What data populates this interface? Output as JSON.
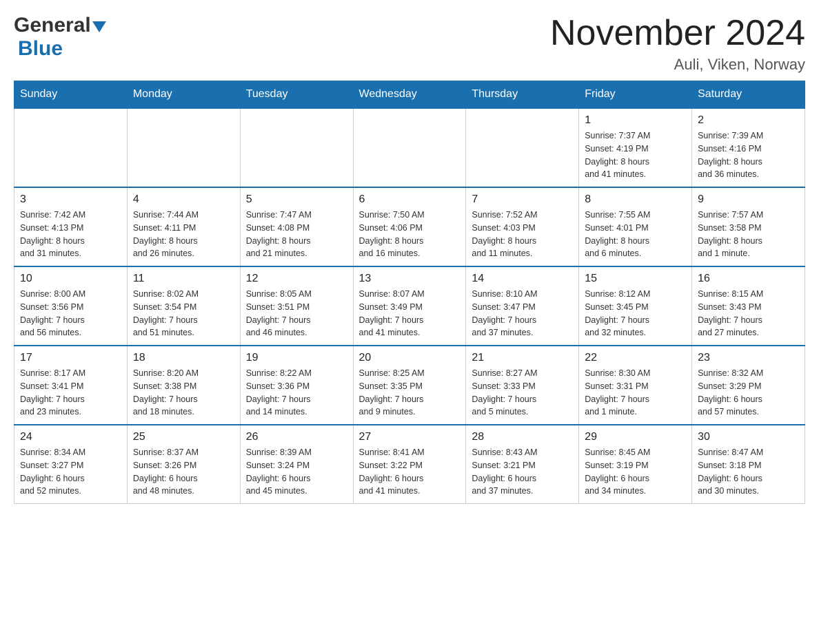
{
  "header": {
    "title": "November 2024",
    "location": "Auli, Viken, Norway",
    "logo_general": "General",
    "logo_blue": "Blue"
  },
  "days_of_week": [
    "Sunday",
    "Monday",
    "Tuesday",
    "Wednesday",
    "Thursday",
    "Friday",
    "Saturday"
  ],
  "weeks": [
    {
      "days": [
        {
          "number": "",
          "info": "",
          "empty": true
        },
        {
          "number": "",
          "info": "",
          "empty": true
        },
        {
          "number": "",
          "info": "",
          "empty": true
        },
        {
          "number": "",
          "info": "",
          "empty": true
        },
        {
          "number": "",
          "info": "",
          "empty": true
        },
        {
          "number": "1",
          "info": "Sunrise: 7:37 AM\nSunset: 4:19 PM\nDaylight: 8 hours\nand 41 minutes.",
          "empty": false
        },
        {
          "number": "2",
          "info": "Sunrise: 7:39 AM\nSunset: 4:16 PM\nDaylight: 8 hours\nand 36 minutes.",
          "empty": false
        }
      ]
    },
    {
      "days": [
        {
          "number": "3",
          "info": "Sunrise: 7:42 AM\nSunset: 4:13 PM\nDaylight: 8 hours\nand 31 minutes.",
          "empty": false
        },
        {
          "number": "4",
          "info": "Sunrise: 7:44 AM\nSunset: 4:11 PM\nDaylight: 8 hours\nand 26 minutes.",
          "empty": false
        },
        {
          "number": "5",
          "info": "Sunrise: 7:47 AM\nSunset: 4:08 PM\nDaylight: 8 hours\nand 21 minutes.",
          "empty": false
        },
        {
          "number": "6",
          "info": "Sunrise: 7:50 AM\nSunset: 4:06 PM\nDaylight: 8 hours\nand 16 minutes.",
          "empty": false
        },
        {
          "number": "7",
          "info": "Sunrise: 7:52 AM\nSunset: 4:03 PM\nDaylight: 8 hours\nand 11 minutes.",
          "empty": false
        },
        {
          "number": "8",
          "info": "Sunrise: 7:55 AM\nSunset: 4:01 PM\nDaylight: 8 hours\nand 6 minutes.",
          "empty": false
        },
        {
          "number": "9",
          "info": "Sunrise: 7:57 AM\nSunset: 3:58 PM\nDaylight: 8 hours\nand 1 minute.",
          "empty": false
        }
      ]
    },
    {
      "days": [
        {
          "number": "10",
          "info": "Sunrise: 8:00 AM\nSunset: 3:56 PM\nDaylight: 7 hours\nand 56 minutes.",
          "empty": false
        },
        {
          "number": "11",
          "info": "Sunrise: 8:02 AM\nSunset: 3:54 PM\nDaylight: 7 hours\nand 51 minutes.",
          "empty": false
        },
        {
          "number": "12",
          "info": "Sunrise: 8:05 AM\nSunset: 3:51 PM\nDaylight: 7 hours\nand 46 minutes.",
          "empty": false
        },
        {
          "number": "13",
          "info": "Sunrise: 8:07 AM\nSunset: 3:49 PM\nDaylight: 7 hours\nand 41 minutes.",
          "empty": false
        },
        {
          "number": "14",
          "info": "Sunrise: 8:10 AM\nSunset: 3:47 PM\nDaylight: 7 hours\nand 37 minutes.",
          "empty": false
        },
        {
          "number": "15",
          "info": "Sunrise: 8:12 AM\nSunset: 3:45 PM\nDaylight: 7 hours\nand 32 minutes.",
          "empty": false
        },
        {
          "number": "16",
          "info": "Sunrise: 8:15 AM\nSunset: 3:43 PM\nDaylight: 7 hours\nand 27 minutes.",
          "empty": false
        }
      ]
    },
    {
      "days": [
        {
          "number": "17",
          "info": "Sunrise: 8:17 AM\nSunset: 3:41 PM\nDaylight: 7 hours\nand 23 minutes.",
          "empty": false
        },
        {
          "number": "18",
          "info": "Sunrise: 8:20 AM\nSunset: 3:38 PM\nDaylight: 7 hours\nand 18 minutes.",
          "empty": false
        },
        {
          "number": "19",
          "info": "Sunrise: 8:22 AM\nSunset: 3:36 PM\nDaylight: 7 hours\nand 14 minutes.",
          "empty": false
        },
        {
          "number": "20",
          "info": "Sunrise: 8:25 AM\nSunset: 3:35 PM\nDaylight: 7 hours\nand 9 minutes.",
          "empty": false
        },
        {
          "number": "21",
          "info": "Sunrise: 8:27 AM\nSunset: 3:33 PM\nDaylight: 7 hours\nand 5 minutes.",
          "empty": false
        },
        {
          "number": "22",
          "info": "Sunrise: 8:30 AM\nSunset: 3:31 PM\nDaylight: 7 hours\nand 1 minute.",
          "empty": false
        },
        {
          "number": "23",
          "info": "Sunrise: 8:32 AM\nSunset: 3:29 PM\nDaylight: 6 hours\nand 57 minutes.",
          "empty": false
        }
      ]
    },
    {
      "days": [
        {
          "number": "24",
          "info": "Sunrise: 8:34 AM\nSunset: 3:27 PM\nDaylight: 6 hours\nand 52 minutes.",
          "empty": false
        },
        {
          "number": "25",
          "info": "Sunrise: 8:37 AM\nSunset: 3:26 PM\nDaylight: 6 hours\nand 48 minutes.",
          "empty": false
        },
        {
          "number": "26",
          "info": "Sunrise: 8:39 AM\nSunset: 3:24 PM\nDaylight: 6 hours\nand 45 minutes.",
          "empty": false
        },
        {
          "number": "27",
          "info": "Sunrise: 8:41 AM\nSunset: 3:22 PM\nDaylight: 6 hours\nand 41 minutes.",
          "empty": false
        },
        {
          "number": "28",
          "info": "Sunrise: 8:43 AM\nSunset: 3:21 PM\nDaylight: 6 hours\nand 37 minutes.",
          "empty": false
        },
        {
          "number": "29",
          "info": "Sunrise: 8:45 AM\nSunset: 3:19 PM\nDaylight: 6 hours\nand 34 minutes.",
          "empty": false
        },
        {
          "number": "30",
          "info": "Sunrise: 8:47 AM\nSunset: 3:18 PM\nDaylight: 6 hours\nand 30 minutes.",
          "empty": false
        }
      ]
    }
  ]
}
